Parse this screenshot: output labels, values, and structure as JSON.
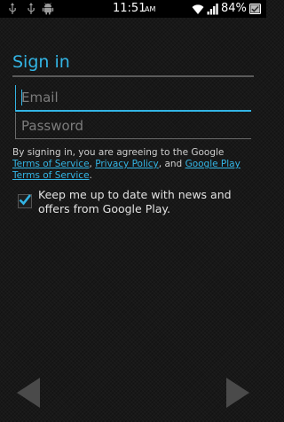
{
  "status_bar": {
    "time": "11:51",
    "ampm": "AM",
    "battery_percent": "84%",
    "left_icons": [
      "usb-icon",
      "usb-debug-icon",
      "android-icon"
    ],
    "right_icons": [
      "wifi-icon",
      "signal-icon",
      "battery-icon"
    ]
  },
  "page": {
    "title": "Sign in"
  },
  "form": {
    "email_placeholder": "Email",
    "password_placeholder": "Password"
  },
  "terms": {
    "prefix": "By signing in, you are agreeing to the Google ",
    "tos_link": "Terms of Service",
    "sep1": ", ",
    "privacy_link": "Privacy Policy",
    "sep2": ", and ",
    "play_tos_link": "Google Play Terms of Service",
    "suffix": "."
  },
  "newsletter": {
    "label": "Keep me up to date with news and offers from Google Play.",
    "checked": true
  },
  "navigation": {
    "back_icon": "arrow-left-icon",
    "next_icon": "arrow-right-icon"
  },
  "colors": {
    "accent": "#33b5e5",
    "background": "#181818",
    "status_bar": "#000000"
  }
}
